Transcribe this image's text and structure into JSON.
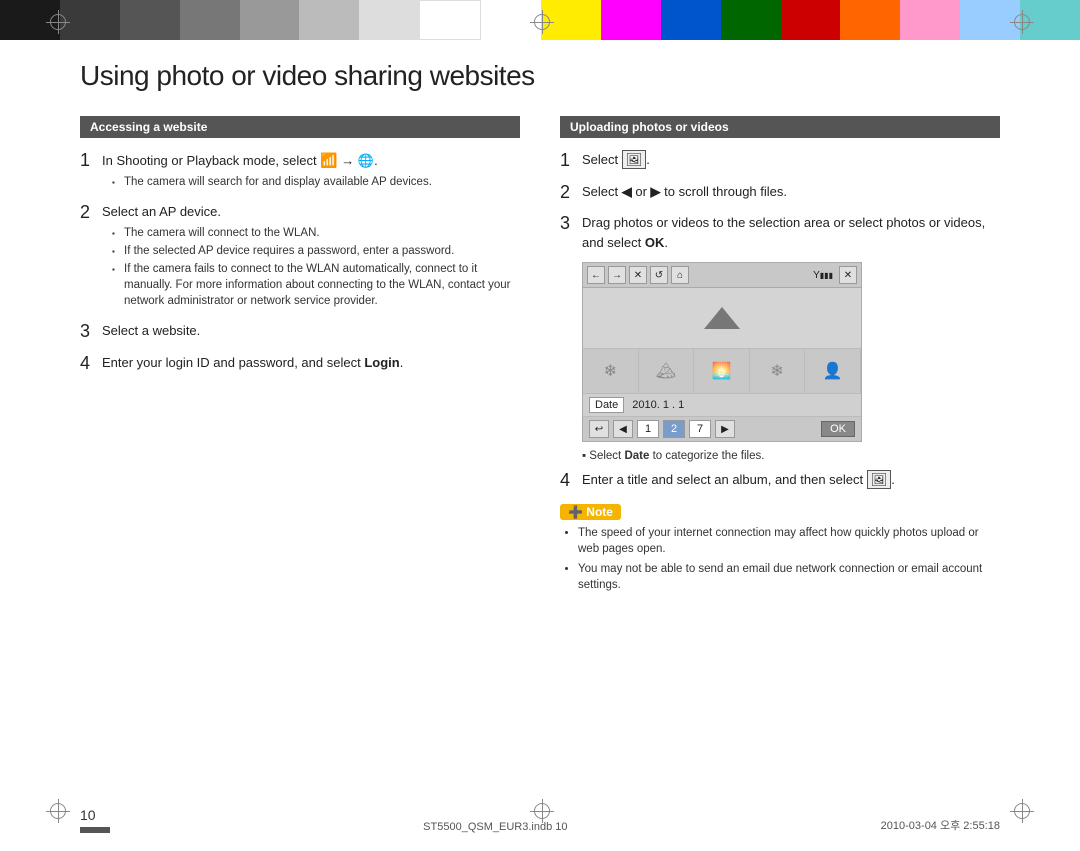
{
  "colorBar": {
    "colors": [
      "#1a1a1a",
      "#3a3a3a",
      "#555555",
      "#777777",
      "#999999",
      "#bbbbbb",
      "#dddddd",
      "#ffffff",
      "#ffffff",
      "#ffec00",
      "#ff00ff",
      "#0066cc",
      "#006600",
      "#cc0000",
      "#ff6600",
      "#ff99cc",
      "#99ccff",
      "#66cccc"
    ]
  },
  "page": {
    "title": "Using photo or video sharing websites",
    "number": "10",
    "file": "ST5500_QSM_EUR3.indb   10",
    "date": "2010-03-04   오후 2:55:18"
  },
  "left": {
    "sectionHeader": "Accessing a website",
    "steps": [
      {
        "num": "1",
        "text": "In Shooting or Playback mode, select ",
        "icon": "wifi-globe-icon",
        "bullets": [
          "The camera will search for and display available AP devices."
        ]
      },
      {
        "num": "2",
        "text": "Select an AP device.",
        "bullets": [
          "The camera will connect to the WLAN.",
          "If the selected AP device requires a password, enter a password.",
          "If the camera fails to connect to the WLAN automatically, connect to it manually. For more information about connecting to the WLAN, contact your network administrator or network service provider."
        ]
      },
      {
        "num": "3",
        "text": "Select a website.",
        "bullets": []
      },
      {
        "num": "4",
        "text": "Enter your login ID and password, and select ",
        "boldSuffix": "Login",
        "suffix": ".",
        "bullets": []
      }
    ]
  },
  "right": {
    "sectionHeader": "Uploading photos or videos",
    "steps": [
      {
        "num": "1",
        "text": "Select ",
        "icon": "upload-icon",
        "suffix": ".",
        "bullets": []
      },
      {
        "num": "2",
        "text": "Select ",
        "leftArrow": "◀",
        "or": " or ",
        "rightArrow": "▶",
        "suffix": " to scroll through files.",
        "bullets": []
      },
      {
        "num": "3",
        "text": "Drag photos or videos to the selection area or select photos or videos, and select ",
        "boldSuffix": "OK",
        "suffix": ".",
        "bullets": []
      }
    ],
    "cameraUI": {
      "toolbar": [
        "←",
        "→",
        "✕",
        "↺",
        "⌂",
        "Y",
        "☰",
        "✕"
      ],
      "dateLabel": "Date",
      "dateValue": "2010. 1 . 1",
      "navNums": [
        "1",
        "2",
        "7"
      ],
      "selectedNav": "2"
    },
    "selectDateNote": "• Select Date to categorize the files.",
    "step4": {
      "num": "4",
      "text": "Enter a title and select an album, and then select ",
      "icon": "upload-icon",
      "suffix": "."
    },
    "note": {
      "label": "Note",
      "items": [
        "The speed of your internet connection may affect how quickly photos upload or web pages open.",
        "You may not be able to send an email due network connection or email account settings."
      ]
    }
  }
}
